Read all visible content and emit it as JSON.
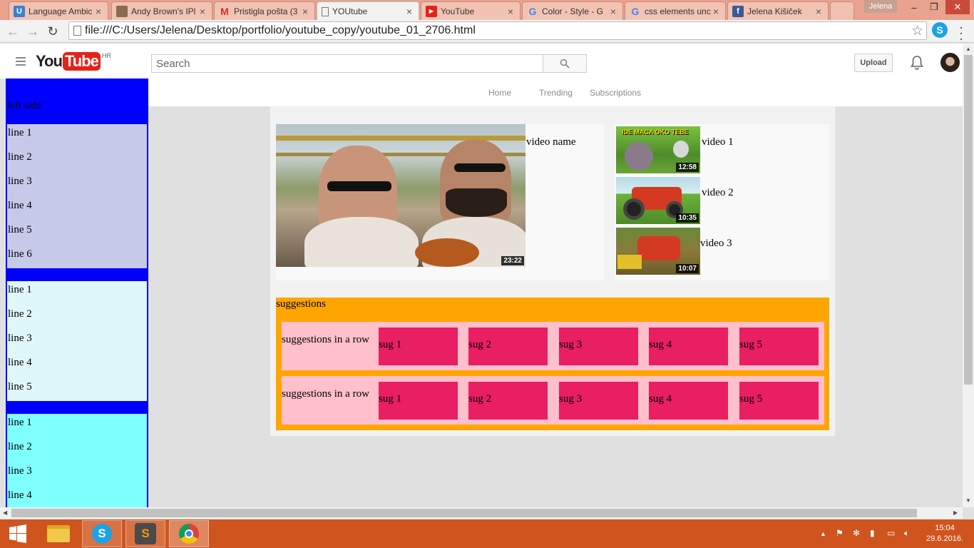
{
  "browser": {
    "tabs": [
      {
        "title": "Language Ambic",
        "icon": "u-icon",
        "color": "#3b7fd1"
      },
      {
        "title": "Andy Brown's IPl",
        "icon": "photo-icon",
        "color": "#8a6a50"
      },
      {
        "title": "Pristigla pošta (3",
        "icon": "gmail-icon",
        "color": "#d93025"
      },
      {
        "title": "YOUtube",
        "icon": "page-icon",
        "color": "#ffffff",
        "active": true
      },
      {
        "title": "YouTube",
        "icon": "youtube-icon",
        "color": "#e62117"
      },
      {
        "title": "Color - Style - G",
        "icon": "google-icon",
        "color": "#4285f4"
      },
      {
        "title": "css elements unc",
        "icon": "google-icon",
        "color": "#4285f4"
      },
      {
        "title": "Jelena Kišiček",
        "icon": "facebook-icon",
        "color": "#3b5998"
      }
    ],
    "user": "Jelena",
    "url": "file:///C:/Users/Jelena/Desktop/portfolio/youtube_copy/youtube_01_2706.html"
  },
  "header": {
    "logo_you": "You",
    "logo_tube": "Tube",
    "logo_region": "HR",
    "search_placeholder": "Search",
    "upload_label": "Upload"
  },
  "left_side": {
    "title": "left side",
    "groups": [
      {
        "color": "#c7c9e8",
        "lines": [
          "line 1",
          "line 2",
          "line 3",
          "line 4",
          "line 5",
          "line 6"
        ]
      },
      {
        "color": "#e0f7fa",
        "lines": [
          "line 1",
          "line 2",
          "line 3",
          "line 4",
          "line 5"
        ]
      },
      {
        "color": "#80ffff",
        "lines": [
          "line 1",
          "line 2",
          "line 3",
          "line 4"
        ]
      }
    ]
  },
  "nav_tabs": [
    "Home",
    "Trending",
    "Subscriptions"
  ],
  "main_video": {
    "name": "video name",
    "duration": "23:22"
  },
  "side_videos": [
    {
      "title": "video 1",
      "duration": "12:58",
      "banner": "IDE MACA OKO TEBE"
    },
    {
      "title": "video 2",
      "duration": "10:35"
    },
    {
      "title": "video 3",
      "duration": "10:07"
    }
  ],
  "suggestions": {
    "title": "suggestions",
    "rows": [
      {
        "label": "suggestions in a row",
        "items": [
          "sug 1",
          "sug 2",
          "sug 3",
          "sug 4",
          "sug 5"
        ]
      },
      {
        "label": "suggestions in a row",
        "items": [
          "sug 1",
          "sug 2",
          "sug 3",
          "sug 4",
          "sug 5"
        ]
      }
    ]
  },
  "taskbar": {
    "time": "15:04",
    "date": "29.6.2016."
  }
}
